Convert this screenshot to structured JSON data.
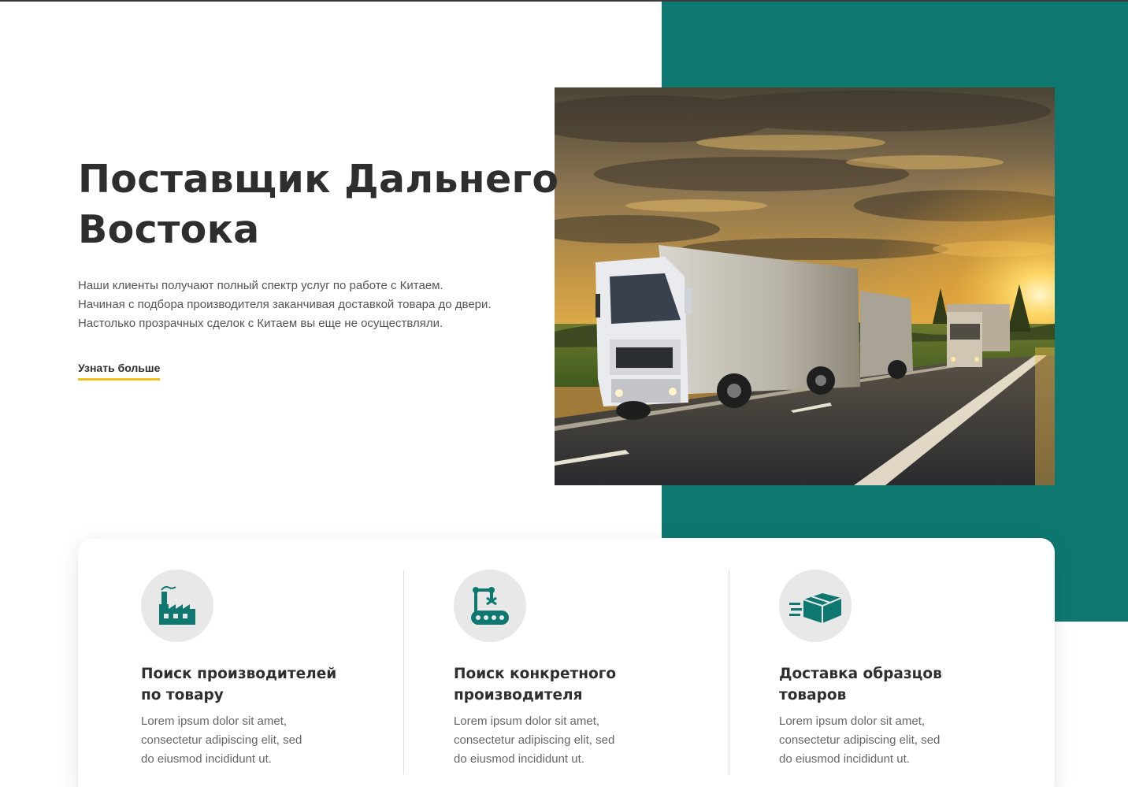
{
  "hero": {
    "title_line1": "Поставщик Дальнего",
    "title_line2": "Востока",
    "text_lines": [
      "Наши клиенты получают полный спектр услуг по работе с Китаем.",
      "Начиная с подбора производителя заканчивая доставкой товара до двери.",
      "Настолько прозрачных сделок с Китаем вы еще не осуществляли."
    ],
    "more_label": "Узнать больше",
    "photo_icon": "trucks-on-highway-sunset-photo"
  },
  "colors": {
    "accent_teal": "#0e7870",
    "underline_yellow": "#f2c21b",
    "heading": "#2e2e2e",
    "icon_circle": "#e8e8e8"
  },
  "services": [
    {
      "icon": "factory-icon",
      "title_lines": [
        "Поиск производителей",
        "по товару"
      ],
      "text_lines": [
        "Lorem ipsum dolor sit amet,",
        "consectetur adipiscing elit, sed",
        "do eiusmod incididunt ut."
      ]
    },
    {
      "icon": "conveyor-robot-icon",
      "title_lines": [
        "Поиск конкретного",
        "производителя"
      ],
      "text_lines": [
        "Lorem ipsum dolor sit amet,",
        "consectetur adipiscing elit, sed",
        "do eiusmod incididunt ut."
      ]
    },
    {
      "icon": "fast-delivery-box-icon",
      "title_lines": [
        "Доставка образцов",
        "товаров"
      ],
      "text_lines": [
        "Lorem ipsum dolor sit amet,",
        "consectetur adipiscing elit, sed",
        "do eiusmod incididunt ut."
      ]
    }
  ]
}
